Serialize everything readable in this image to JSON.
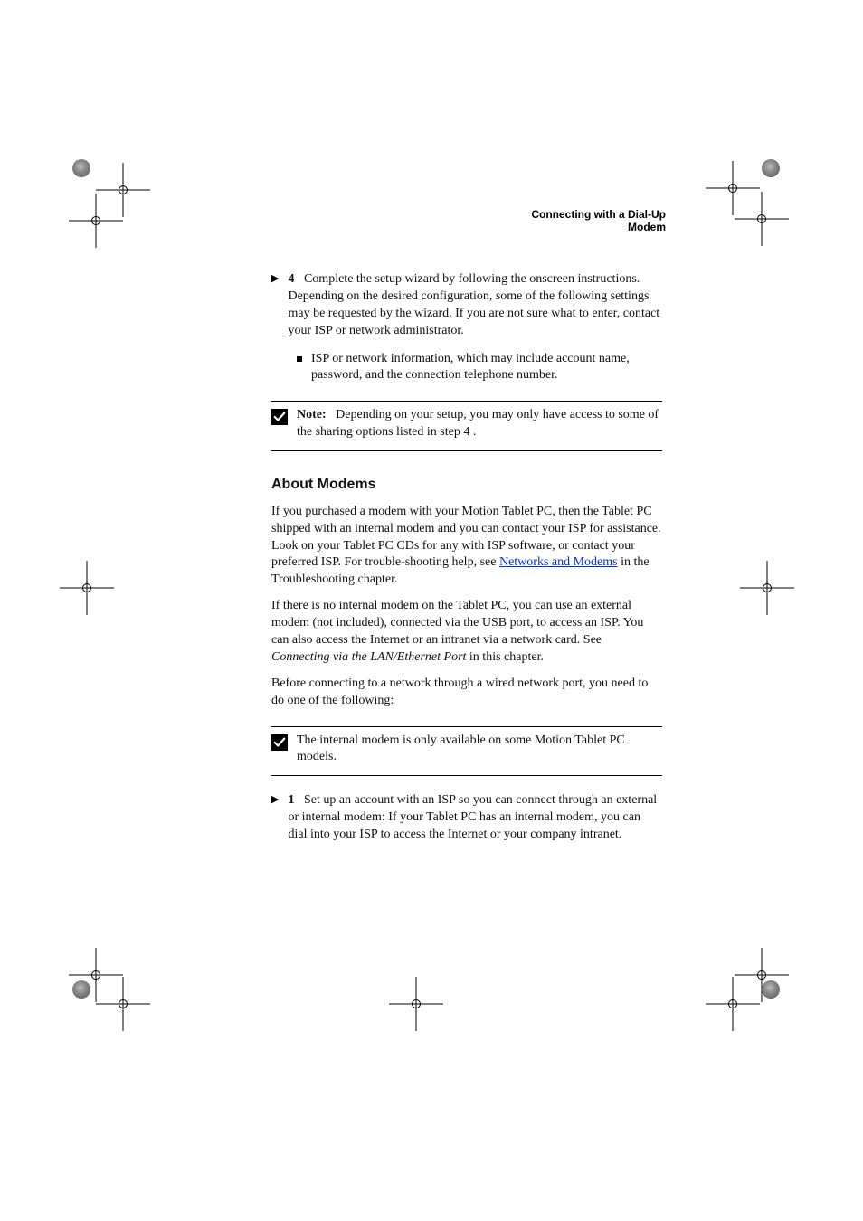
{
  "runhead": {
    "right_line1": "Connecting with a Dial-Up",
    "right_line2": "Modem",
    "left_marker": ""
  },
  "step4": {
    "lead": "4",
    "text_before": "Complete the setup wizard by following the onscreen instructions. Depending on the desired configuration, some of the following settings may be requested by the wizard. If you are not sure what to enter, contact your ISP or network administrator.",
    "bullets": [
      "ISP or network information, which may include account name, password, and the connection telephone number."
    ]
  },
  "note1": {
    "label": "Note:",
    "body_prefix": "Depending on your setup, you may only have access to some of the sharing options listed in step ",
    "body_ref": "4",
    "body_suffix": "."
  },
  "heading1": "About Modems",
  "about": {
    "p1_pre": "If you purchased a modem with your Motion Tablet PC, then the Tablet PC shipped with an internal modem and you can contact your ISP for assistance. Look on your Tablet PC CDs for any with ISP software, or contact your preferred ISP. For trouble-shooting help, see ",
    "p1_link": "Networks and Modems",
    "p1_post": " in the Troubleshooting chapter.",
    "p2_pre": "If there is no internal modem on the Tablet PC, you can use an external modem (not included), connected via the USB port, to access an ISP. You can also access the Internet or an intranet via a network card. See ",
    "p2_em": "Connecting via the LAN/Ethernet Port",
    "p2_post": " in this chapter.",
    "p3": "Before connecting to a network through a wired network port, you need to do one of the following:"
  },
  "note2": {
    "body": "The internal modem is only available on some Motion Tablet PC models."
  },
  "step_network": {
    "lead": "1",
    "text": "Set up an account with an ISP so you can connect through an external or internal modem: If your Tablet PC has an internal modem, you can dial into your ISP to access the Internet or your company intranet."
  }
}
